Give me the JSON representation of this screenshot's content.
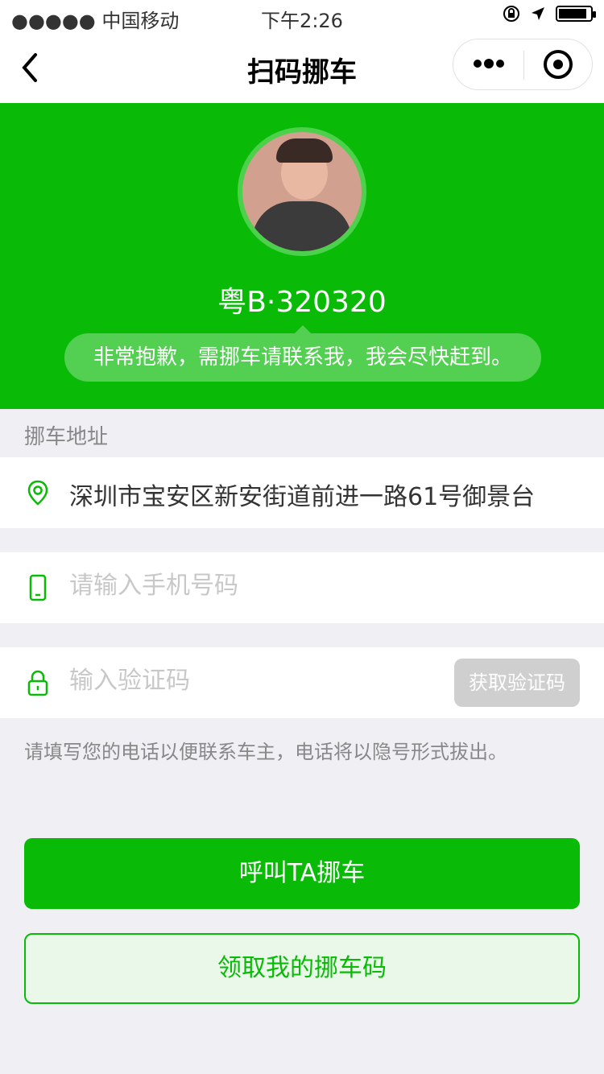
{
  "status_bar": {
    "carrier": "●●●●● 中国移动",
    "time": "下午2:26"
  },
  "nav": {
    "back_icon": "chevron-left-icon",
    "title": "扫码挪车",
    "more_icon": "more-dots-icon",
    "target_icon": "target-icon"
  },
  "profile": {
    "plate": "粤B·320320",
    "message": "非常抱歉，需挪车请联系我，我会尽快赶到。"
  },
  "address": {
    "section_label": "挪车地址",
    "icon": "location-pin-icon",
    "value": "深圳市宝安区新安街道前进一路61号御景台"
  },
  "phone": {
    "icon": "phone-icon",
    "placeholder": "请输入手机号码"
  },
  "verify": {
    "icon": "lock-icon",
    "placeholder": "输入验证码",
    "button_label": "获取验证码"
  },
  "hint": "请填写您的电话以便联系车主，电话将以隐号形式拔出。",
  "actions": {
    "call_label": "呼叫TA挪车",
    "get_code_label": "领取我的挪车码"
  },
  "colors": {
    "brand_green": "#09bb07",
    "secondary_text": "#888888",
    "placeholder_text": "#c8c8c8",
    "primary_text": "#333333"
  }
}
